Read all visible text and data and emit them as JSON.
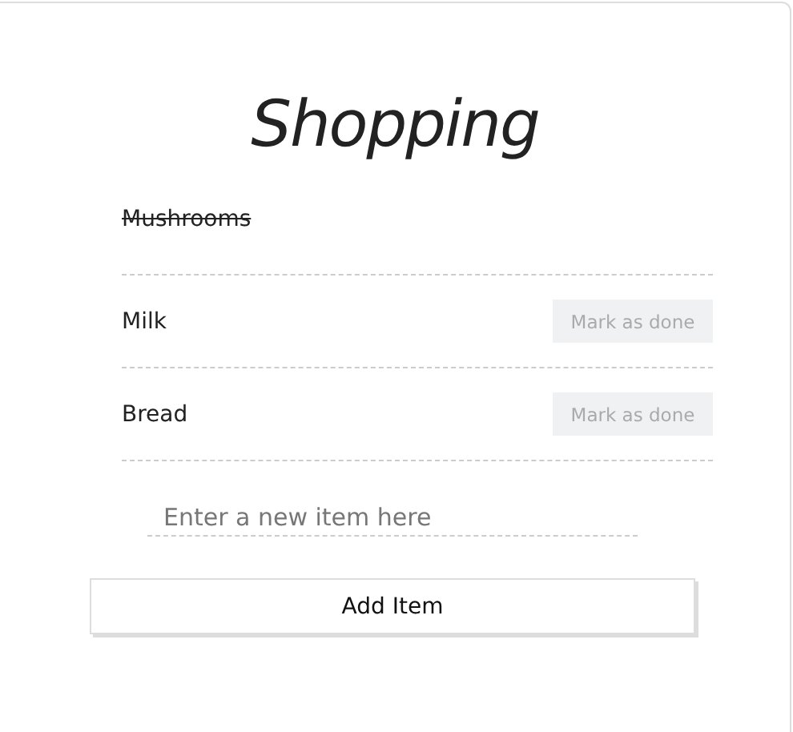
{
  "title": "Shopping",
  "items": [
    {
      "name": "Mushrooms",
      "done": true
    },
    {
      "name": "Milk",
      "done": false,
      "action": "Mark as done"
    },
    {
      "name": "Bread",
      "done": false,
      "action": "Mark as done"
    }
  ],
  "new_item": {
    "placeholder": "Enter a new item here"
  },
  "add_button": "Add Item"
}
